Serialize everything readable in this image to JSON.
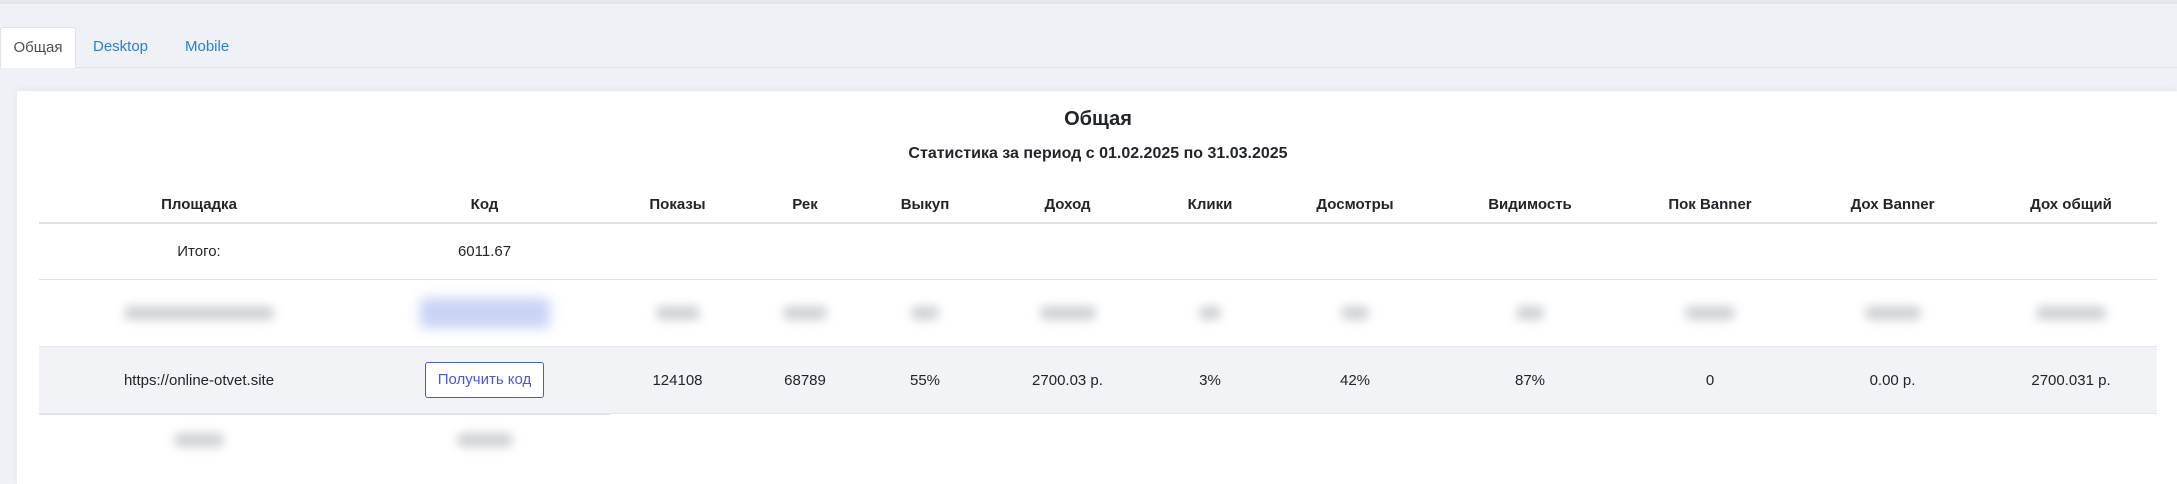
{
  "tabs": [
    {
      "label": "Общая",
      "active": true
    },
    {
      "label": "Desktop",
      "active": false
    },
    {
      "label": "Mobile",
      "active": false
    }
  ],
  "report": {
    "title": "Общая",
    "subtitle": "Статистика за период с 01.02.2025 по 31.03.2025"
  },
  "table": {
    "headers": [
      "Площадка",
      "Код",
      "Показы",
      "Рек",
      "Выкуп",
      "Доход",
      "Клики",
      "Досмотры",
      "Видимость",
      "Пок Banner",
      "Дох Banner",
      "Дох общий"
    ],
    "total": {
      "label": "Итого:",
      "code_value": "6011.67"
    },
    "site_row": {
      "site": "https://online-otvet.site",
      "button_label": "Получить код",
      "shows": "124108",
      "ads": "68789",
      "buyout": "55%",
      "income": "2700.03 р.",
      "clicks": "3%",
      "views": "42%",
      "visibility": "87%",
      "banner_shows": "0",
      "banner_income": "0.00 р.",
      "total_income": "2700.031 р."
    }
  },
  "colors": {
    "tab_link": "#2b7fd4",
    "button_accent": "#4d59c9",
    "highlight_row": "#f1f3f6",
    "page_background": "#eef1f5"
  }
}
